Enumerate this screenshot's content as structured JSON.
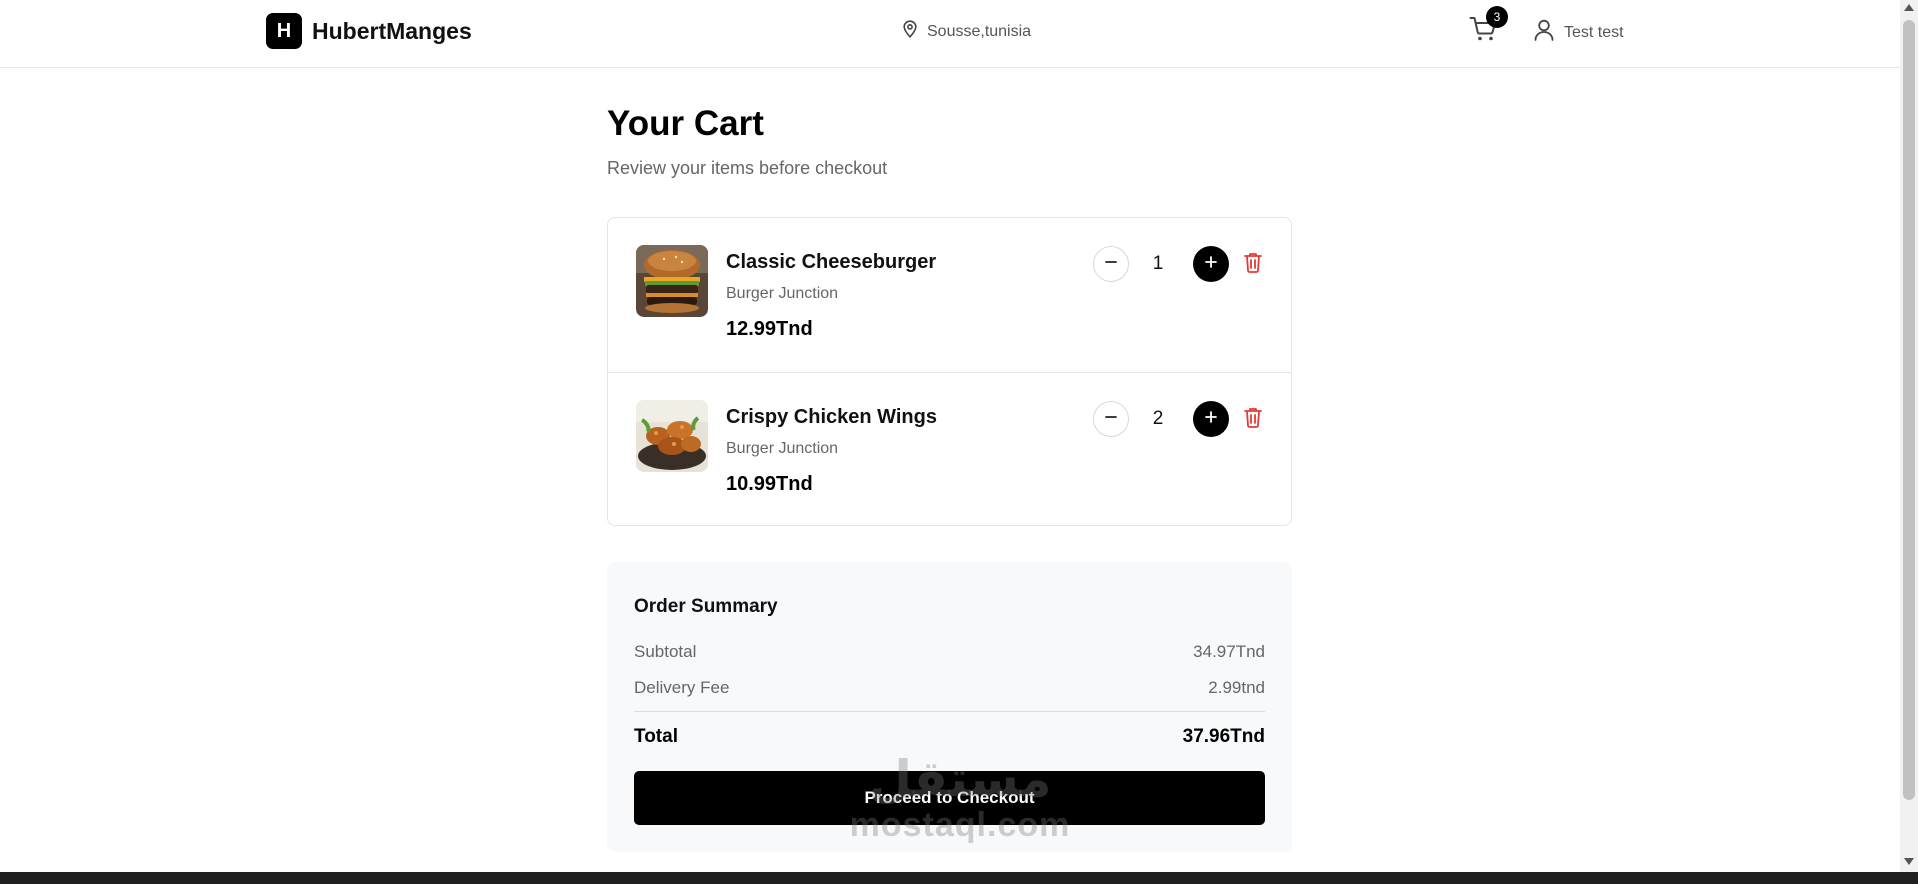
{
  "header": {
    "brand_initial": "H",
    "brand_name": "HubertManges",
    "location": "Sousse,tunisia",
    "cart_count": "3",
    "user_name": "Test test"
  },
  "page": {
    "title": "Your Cart",
    "subtitle": "Review your items before checkout"
  },
  "cart": {
    "items": [
      {
        "name": "Classic Cheeseburger",
        "restaurant": "Burger Junction",
        "price": "12.99Tnd",
        "quantity": "1",
        "image_icon": "cheeseburger-photo"
      },
      {
        "name": "Crispy Chicken Wings",
        "restaurant": "Burger Junction",
        "price": "10.99Tnd",
        "quantity": "2",
        "image_icon": "chicken-wings-photo"
      }
    ]
  },
  "summary": {
    "title": "Order Summary",
    "subtotal_label": "Subtotal",
    "subtotal_value": "34.97Tnd",
    "delivery_label": "Delivery Fee",
    "delivery_value": "2.99tnd",
    "total_label": "Total",
    "total_value": "37.96Tnd",
    "checkout_label": "Proceed to Checkout"
  },
  "watermark": {
    "logo": "مستقل",
    "text": "mostaql.com"
  },
  "colors": {
    "accent": "#000000",
    "delete": "#e53935",
    "muted_text": "#666666",
    "summary_bg": "#f8f9fa"
  }
}
